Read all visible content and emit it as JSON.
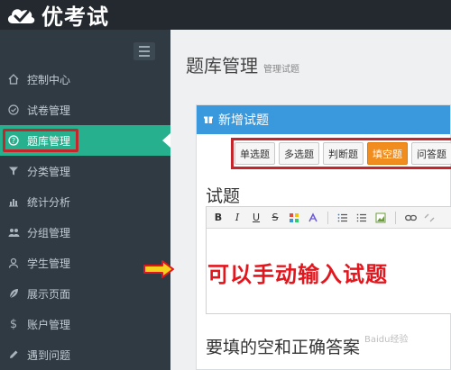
{
  "brand": {
    "name": "优考试",
    "logo_icon": "cloud-check-icon"
  },
  "sidebar": {
    "items": [
      {
        "label": "控制中心",
        "icon": "home-icon",
        "active": false
      },
      {
        "label": "试卷管理",
        "icon": "check-circle-icon",
        "active": false
      },
      {
        "label": "题库管理",
        "icon": "question-circle-icon",
        "active": true
      },
      {
        "label": "分类管理",
        "icon": "filter-icon",
        "active": false
      },
      {
        "label": "统计分析",
        "icon": "bar-chart-icon",
        "active": false
      },
      {
        "label": "分组管理",
        "icon": "users-icon",
        "active": false
      },
      {
        "label": "学生管理",
        "icon": "user-icon",
        "active": false
      },
      {
        "label": "展示页面",
        "icon": "leaf-icon",
        "active": false
      },
      {
        "label": "账户管理",
        "icon": "dollar-icon",
        "active": false
      },
      {
        "label": "遇到问题",
        "icon": "pencil-icon",
        "active": false
      }
    ]
  },
  "page": {
    "title": "题库管理",
    "subtitle": "管理试题"
  },
  "panel": {
    "title": "新增试题",
    "question_types": [
      "单选题",
      "多选题",
      "判断题",
      "填空题",
      "问答题"
    ],
    "selected_type": "填空题",
    "question_label": "试题",
    "blank_label": "要填的空和正确答案"
  },
  "annotation": {
    "text": "可以手动输入试题"
  },
  "watermark": "Baidu经验",
  "colors": {
    "accent": "#27b08e",
    "panel_header": "#3a98dc",
    "active_type": "#f08d1e",
    "highlight_border": "#c4262b",
    "annotation": "#e3161d"
  }
}
